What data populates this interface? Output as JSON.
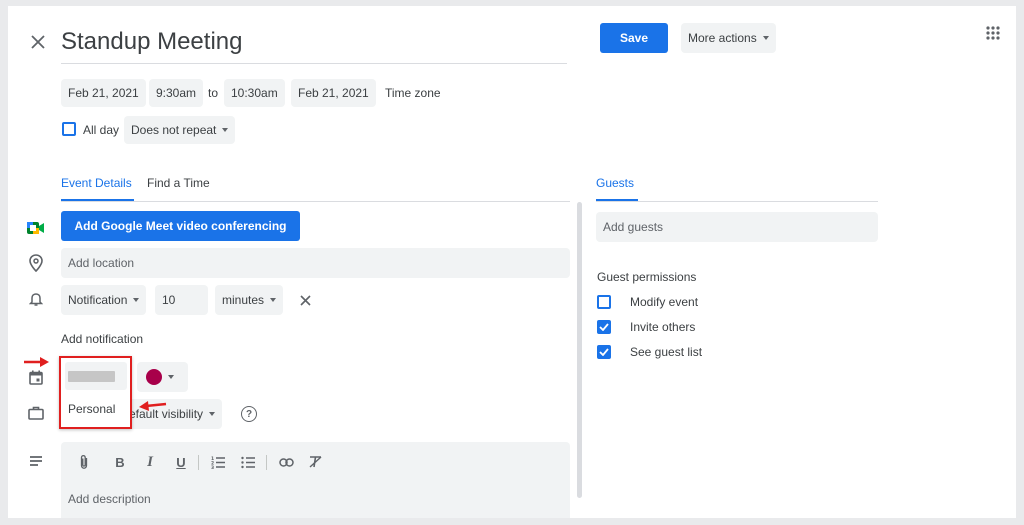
{
  "header": {
    "title": "Standup Meeting",
    "save_label": "Save",
    "more_actions_label": "More actions"
  },
  "datetime": {
    "start_date": "Feb 21, 2021",
    "start_time": "9:30am",
    "to_label": "to",
    "end_time": "10:30am",
    "end_date": "Feb 21, 2021",
    "time_zone_label": "Time zone",
    "all_day_label": "All day",
    "all_day_checked": false,
    "repeat_label": "Does not repeat"
  },
  "tabs": {
    "event_details": "Event Details",
    "find_a_time": "Find a Time",
    "guests": "Guests"
  },
  "details": {
    "meet_button_label": "Add Google Meet video conferencing",
    "location_placeholder": "Add location",
    "notification_type": "Notification",
    "notification_value": "10",
    "notification_unit": "minutes",
    "add_notification_label": "Add notification",
    "calendar_dropdown_option": "Personal",
    "event_color": "#a8004a",
    "visibility_label": "Default visibility",
    "visibility_visible_text": "efault visibility",
    "description_placeholder": "Add description"
  },
  "guests": {
    "add_guests_placeholder": "Add guests",
    "permissions_title": "Guest permissions",
    "permissions": [
      {
        "label": "Modify event",
        "checked": false
      },
      {
        "label": "Invite others",
        "checked": true
      },
      {
        "label": "See guest list",
        "checked": true
      }
    ]
  },
  "colors": {
    "accent": "#1a73e8",
    "annotation_red": "#e01f1f",
    "chip_bg": "#f1f3f4"
  },
  "icons": [
    "close-icon",
    "apps-grid-icon",
    "google-meet-icon",
    "location-pin-icon",
    "bell-icon",
    "calendar-icon",
    "briefcase-icon",
    "help-icon",
    "description-icon",
    "attachment-icon",
    "bold-icon",
    "italic-icon",
    "underline-icon",
    "numbered-list-icon",
    "bulleted-list-icon",
    "link-icon",
    "clear-format-icon"
  ]
}
